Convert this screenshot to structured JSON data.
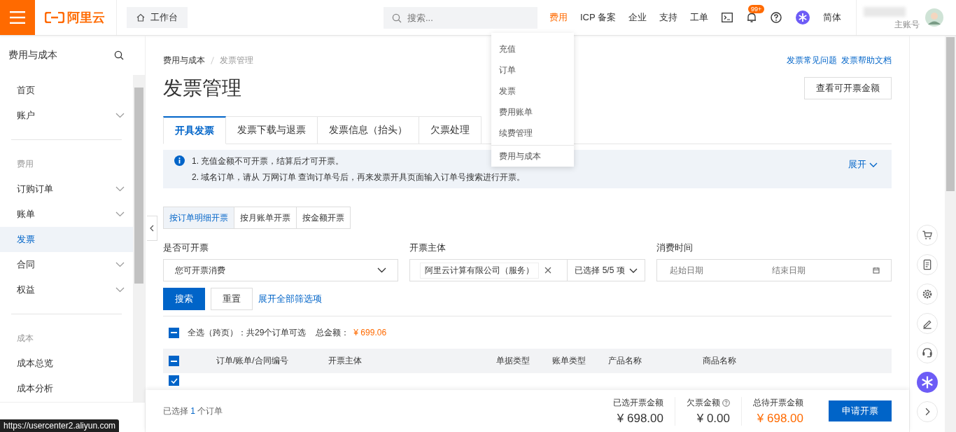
{
  "topbar": {
    "brand": "阿里云",
    "workbench": "工作台",
    "search": {
      "placeholder": "搜索..."
    },
    "nav": [
      {
        "label": "费用",
        "selected": true
      },
      {
        "label": "ICP 备案",
        "selected": false
      },
      {
        "label": "企业",
        "selected": false
      },
      {
        "label": "支持",
        "selected": false
      },
      {
        "label": "工单",
        "selected": false
      }
    ],
    "notification_badge": "99+",
    "language": "简体",
    "account": "主账号"
  },
  "dropdown": {
    "items": [
      "充值",
      "订单",
      "发票",
      "费用账单",
      "续费管理"
    ],
    "footer": "费用与成本"
  },
  "sidebar": {
    "title": "费用与成本",
    "items": [
      {
        "kind": "item",
        "label": "首页",
        "expandable": false,
        "selected": false
      },
      {
        "kind": "item",
        "label": "账户",
        "expandable": true,
        "selected": false
      },
      {
        "kind": "divider"
      },
      {
        "kind": "group",
        "label": "费用"
      },
      {
        "kind": "item",
        "label": "订购订单",
        "expandable": true,
        "selected": false
      },
      {
        "kind": "item",
        "label": "账单",
        "expandable": true,
        "selected": false
      },
      {
        "kind": "item",
        "label": "发票",
        "expandable": false,
        "selected": true
      },
      {
        "kind": "item",
        "label": "合同",
        "expandable": true,
        "selected": false
      },
      {
        "kind": "item",
        "label": "权益",
        "expandable": true,
        "selected": false
      },
      {
        "kind": "divider"
      },
      {
        "kind": "group",
        "label": "成本"
      },
      {
        "kind": "item",
        "label": "成本总览",
        "expandable": false,
        "selected": false
      },
      {
        "kind": "item",
        "label": "成本分析",
        "expandable": false,
        "selected": false
      }
    ]
  },
  "breadcrumb": [
    "费用与成本",
    "发票管理"
  ],
  "help_links": [
    "发票常见问题",
    "发票帮助文档"
  ],
  "title": "发票管理",
  "header_button": "查看可开票金额",
  "tabs": [
    {
      "label": "开具发票",
      "selected": true
    },
    {
      "label": "发票下载与退票",
      "selected": false
    },
    {
      "label": "发票信息（抬头）",
      "selected": false
    },
    {
      "label": "欠票处理",
      "selected": false
    }
  ],
  "notice": {
    "lines": [
      "1. 充值金额不可开票，结算后才可开票。",
      "2. 域名订单，请从 万网订单 查询订单号后，再来发票开具页面输入订单号搜索进行开票。"
    ],
    "toggle": "展开"
  },
  "mode_tabs": [
    {
      "label": "按订单明细开票",
      "selected": true
    },
    {
      "label": "按月账单开票",
      "selected": false
    },
    {
      "label": "按金额开票",
      "selected": false
    }
  ],
  "filters": [
    {
      "kind": "select",
      "label": "是否可开票",
      "value": "您可开票消费"
    },
    {
      "kind": "tags",
      "label": "开票主体",
      "tag": "阿里云计算有限公司（服务）",
      "summary": "已选择 5/5 项"
    },
    {
      "kind": "daterange",
      "label": "消费时间",
      "start_placeholder": "起始日期",
      "end_placeholder": "结束日期"
    }
  ],
  "actions": {
    "search": "搜索",
    "reset": "重置",
    "expand": "展开全部筛选项"
  },
  "select_all": {
    "label": "全选（跨页）：共29个订单可选",
    "total_label": "总金额：",
    "total": "¥ 699.06",
    "indeterminate": true
  },
  "table": {
    "header_indeterminate": true,
    "columns": [
      "订单/账单/合同编号",
      "开票主体",
      "单据类型",
      "账单类型",
      "产品名称",
      "商品名称"
    ],
    "rows": [
      {
        "checked": true
      }
    ]
  },
  "footer": {
    "selected_prefix": "已选择",
    "selected_count": "1",
    "selected_suffix": "个订单",
    "summaries": [
      {
        "label": "已选开票金额",
        "value": "¥ 698.00",
        "highlight": false,
        "help": false
      },
      {
        "label": "欠票金额",
        "value": "¥ 0.00",
        "highlight": false,
        "help": true
      },
      {
        "label": "总待开票金额",
        "value": "¥ 698.00",
        "highlight": true,
        "help": false
      }
    ],
    "submit": "申请开票"
  },
  "status_url": "https://usercenter2.aliyun.com"
}
